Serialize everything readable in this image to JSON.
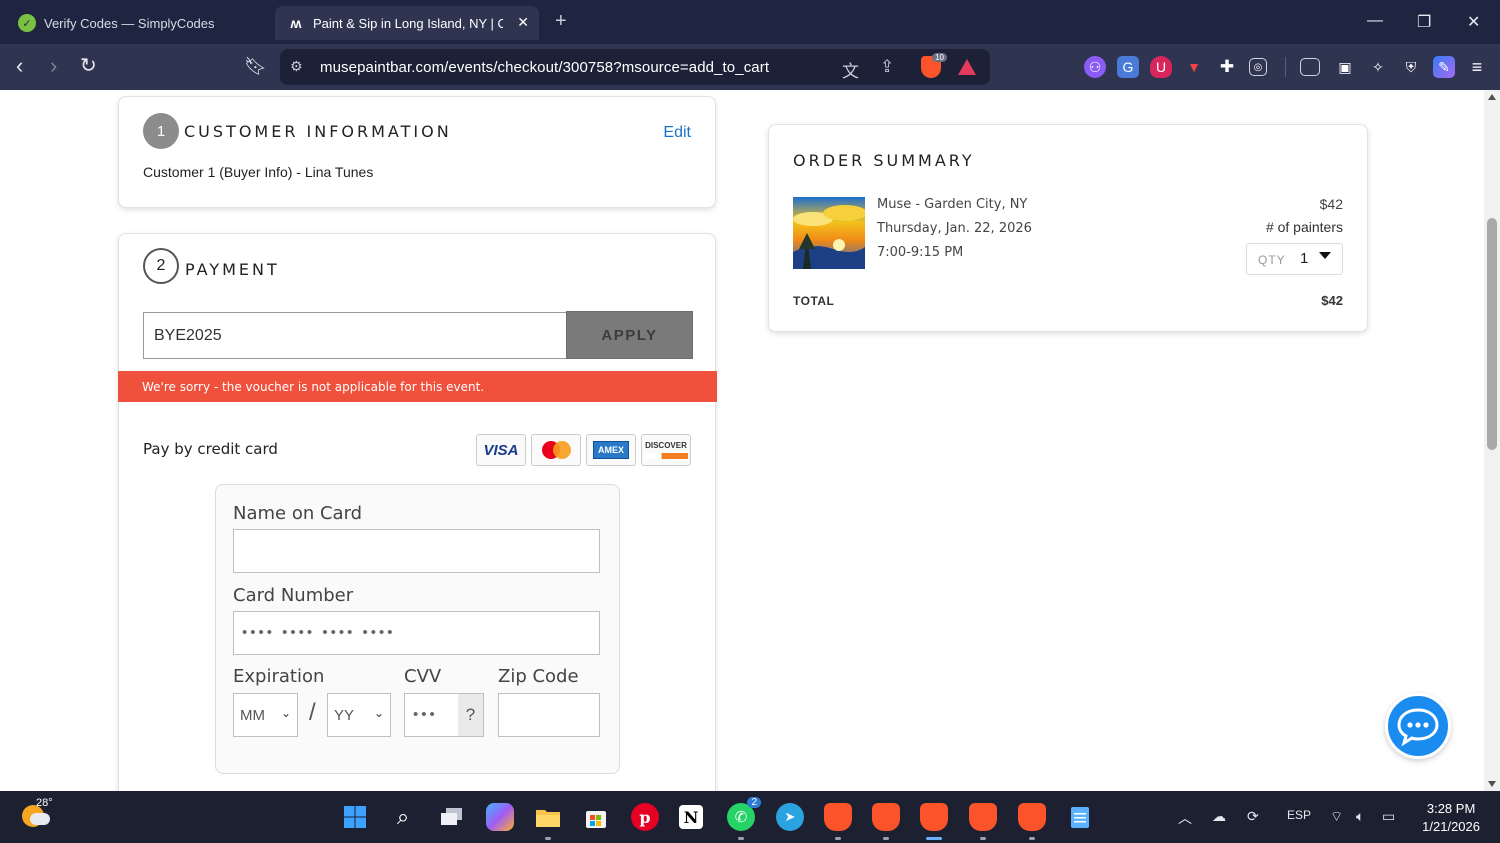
{
  "browser": {
    "tabs": [
      {
        "label": "Verify Codes — SimplyCodes",
        "active": false,
        "favicon": "simplycodes-icon"
      },
      {
        "label": "Paint & Sip in Long Island, NY | C",
        "active": true,
        "favicon": "muse-logo-icon"
      }
    ],
    "new_tab": "+",
    "url": "musepaintbar.com/events/checkout/300758?msource=add_to_cart",
    "shield_count": "10"
  },
  "customer_info": {
    "step": "1",
    "title": "CUSTOMER INFORMATION",
    "edit_label": "Edit",
    "line": "Customer 1 (Buyer Info) - Lina Tunes"
  },
  "payment": {
    "step": "2",
    "title": "PAYMENT",
    "voucher_value": "BYE2025",
    "apply_label": "APPLY",
    "error_message": "We're sorry - the voucher is not applicable for this event.",
    "pay_by_label": "Pay by credit card",
    "card_brands": [
      "VISA",
      "MasterCard",
      "AMEX",
      "DISCOVER"
    ],
    "form": {
      "name_label": "Name on Card",
      "name_value": "",
      "number_label": "Card Number",
      "number_mask": "•••• •••• •••• ••••",
      "expiration_label": "Expiration",
      "month_placeholder": "MM",
      "year_placeholder": "YY",
      "separator": "/",
      "cvv_label": "CVV",
      "cvv_mask": "•••",
      "cvv_help": "?",
      "zip_label": "Zip Code",
      "zip_value": ""
    }
  },
  "order_summary": {
    "title": "ORDER SUMMARY",
    "venue": "Muse - Garden City, NY",
    "date": "Thursday, Jan. 22, 2026",
    "time": "7:00-9:15 PM",
    "price": "$42",
    "unit_label": "# of painters",
    "qty_label": "QTY",
    "qty_value": "1",
    "total_label": "TOTAL",
    "total_value": "$42"
  },
  "taskbar": {
    "temperature": "28°",
    "whatsapp_badge": "2",
    "language": "ESP",
    "time": "3:28 PM",
    "date": "1/21/2026"
  },
  "colors": {
    "error": "#f0513c",
    "link": "#1a73c8",
    "chat": "#1a8cf0",
    "apply_button": "#7a7a7a"
  }
}
